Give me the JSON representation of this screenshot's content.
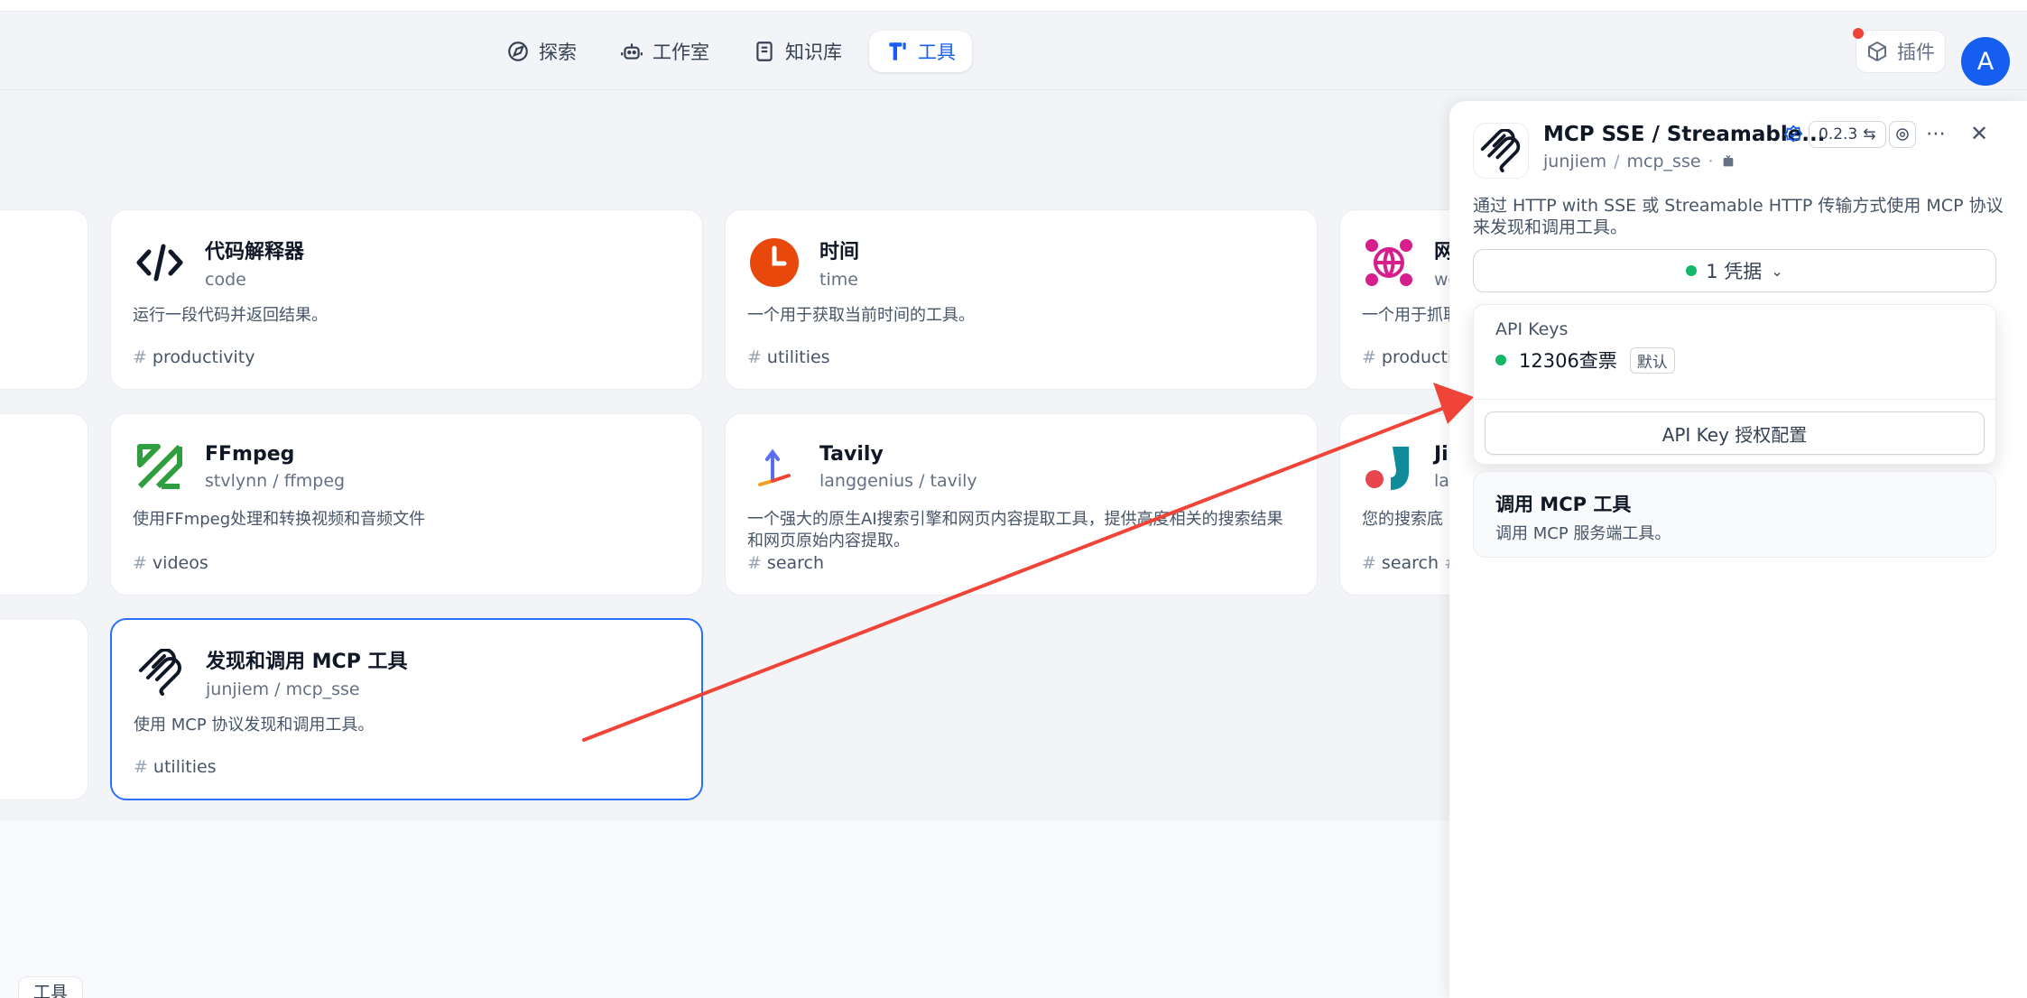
{
  "nav": {
    "items": [
      {
        "label": "探索",
        "icon": "compass-icon",
        "active": false
      },
      {
        "label": "工作室",
        "icon": "robot-icon",
        "active": false
      },
      {
        "label": "知识库",
        "icon": "book-icon",
        "active": false
      },
      {
        "label": "工具",
        "icon": "tools-icon",
        "active": true
      }
    ]
  },
  "header": {
    "plugin_label": "插件",
    "avatar_letter": "A"
  },
  "cards": [
    {
      "title": "代码解释器",
      "sub": "code",
      "desc": "运行一段代码并返回结果。",
      "tag": "productivity"
    },
    {
      "title": "时间",
      "sub": "time",
      "desc": "一个用于获取当前时间的工具。",
      "tag": "utilities"
    },
    {
      "title": "网",
      "sub": "we",
      "desc": "一个用于抓取",
      "tag": "productiv"
    },
    {
      "title": "FFmpeg",
      "sub_author": "stvlynn",
      "sub_name": "ffmpeg",
      "desc": "使用FFmpeg处理和转换视频和音频文件",
      "tag": "videos"
    },
    {
      "title": "Tavily",
      "sub_author": "langgenius",
      "sub_name": "tavily",
      "desc": "一个强大的原生AI搜索引擎和网页内容提取工具，提供高度相关的搜索结果和网页原始内容提取。",
      "tag": "search"
    },
    {
      "title": "Ji",
      "sub": "lan",
      "desc": "您的搜索底",
      "tag": "search"
    },
    {
      "title": "发现和调用 MCP 工具",
      "sub_author": "junjiem",
      "sub_name": "mcp_sse",
      "desc": "使用 MCP 协议发现和调用工具。",
      "tag": "utilities"
    }
  ],
  "bottom": {
    "label": "工具"
  },
  "panel": {
    "title": "MCP SSE / Streamable...",
    "version": "0.2.3",
    "author": "junjiem",
    "name": "mcp_sse",
    "description": "通过 HTTP with SSE 或 Streamable HTTP 传输方式使用 MCP 协议来发现和调用工具。",
    "credential_button": "1 凭据",
    "dropdown": {
      "group_label": "API Keys",
      "item_label": "12306查票",
      "item_badge": "默认",
      "config_button": "API Key 授权配置"
    },
    "tool": {
      "title": "调用 MCP 工具",
      "desc": "调用 MCP 服务端工具。"
    }
  },
  "colors": {
    "accent": "#155eef",
    "selected_border": "#2970ff",
    "status_green": "#12b76a",
    "notification_red": "#f04438",
    "annotation_arrow": "#f04438"
  }
}
